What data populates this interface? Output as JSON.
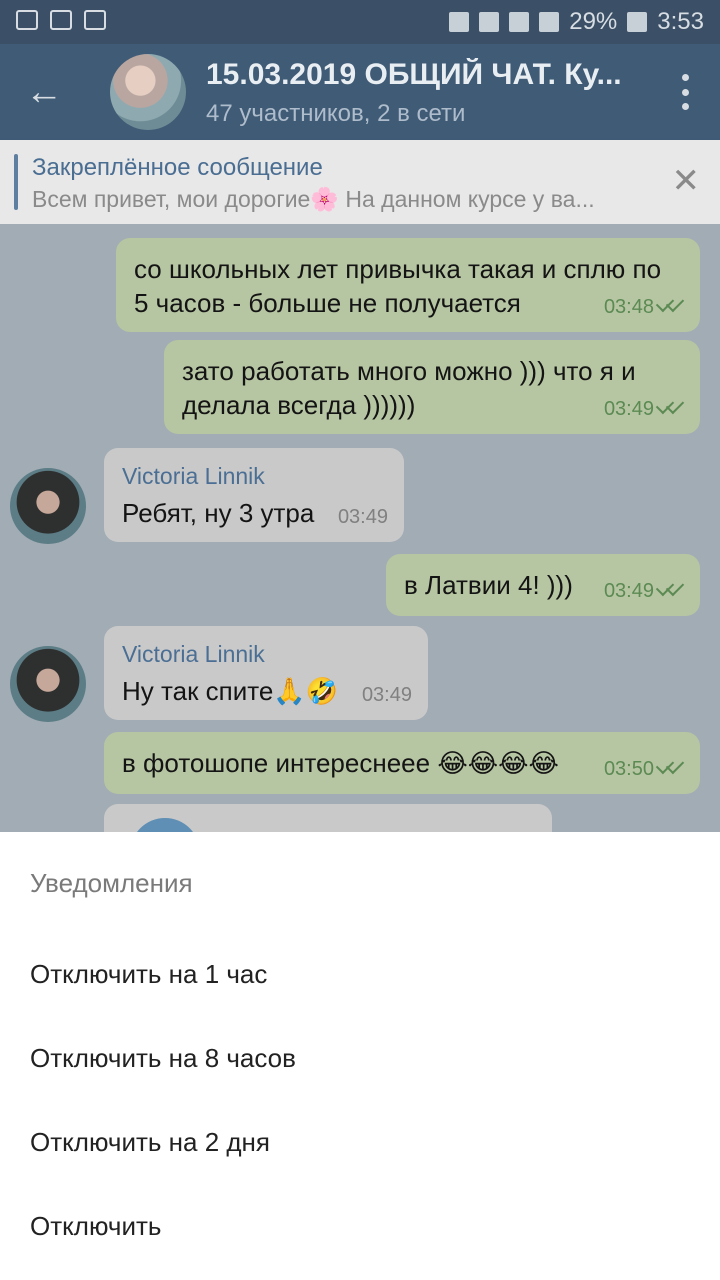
{
  "status_bar": {
    "battery": "29%",
    "time": "3:53"
  },
  "header": {
    "title": "15.03.2019 ОБЩИЙ ЧАТ. Ку...",
    "subtitle": "47 участников, 2 в сети"
  },
  "pinned": {
    "title": "Закреплённое сообщение",
    "text": "Всем привет, мои дорогие🌸 На данном курсе у ва..."
  },
  "messages": [
    {
      "direction": "out",
      "text": "со школьных лет привычка такая и сплю по 5 часов - больше не получается",
      "time": "03:48"
    },
    {
      "direction": "out",
      "text": "зато работать много можно ))) что я и делала всегда ))))))",
      "time": "03:49"
    },
    {
      "direction": "in",
      "sender": "Victoria Linnik",
      "text": "Ребят, ну 3 утра",
      "time": "03:49"
    },
    {
      "direction": "out",
      "text": "в Латвии 4! )))",
      "time": "03:49"
    },
    {
      "direction": "in",
      "sender": "Victoria Linnik",
      "text": "Ну так спите🙏🤣",
      "time": "03:49"
    },
    {
      "direction": "out",
      "text": "в фотошопе интереснеее 😂😂😂😂",
      "time": "03:50"
    }
  ],
  "sheet": {
    "title": "Уведомления",
    "items": [
      "Отключить на 1 час",
      "Отключить на 8 часов",
      "Отключить на 2 дня",
      "Отключить"
    ]
  },
  "colors": {
    "header_bg": "#3f5b76",
    "outgoing_bubble": "#b6c5a2",
    "incoming_bubble": "#c9c9c9",
    "sender_name": "#4b6f94"
  }
}
